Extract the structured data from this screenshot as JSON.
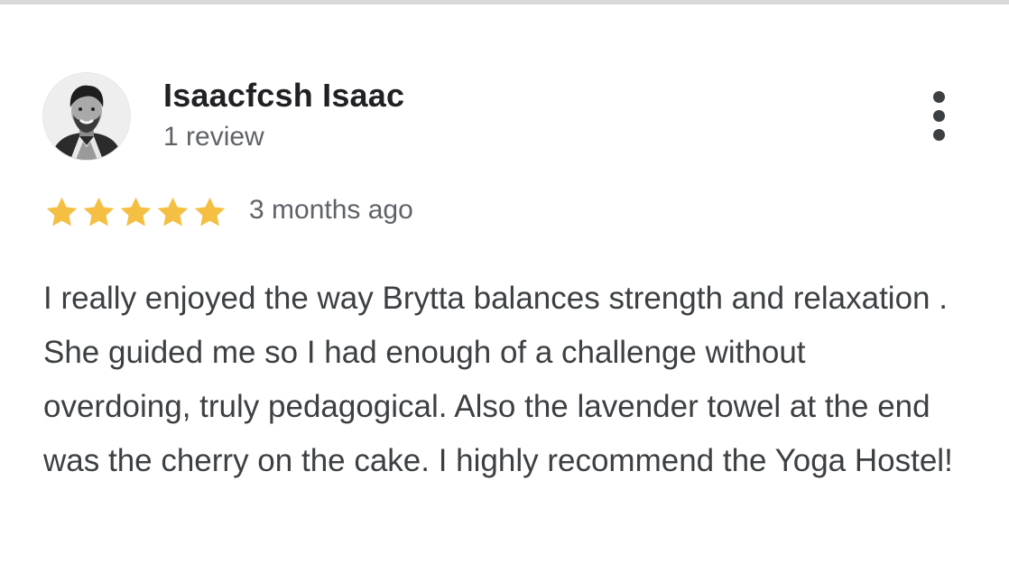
{
  "review": {
    "author_name": "Isaacfcsh Isaac",
    "review_count": "1 review",
    "rating": 5,
    "rating_max": 5,
    "star_color": "#f4bf42",
    "date": "3 months ago",
    "text": "I really enjoyed the way Brytta balances strength and relaxation . She guided me so I had enough of a challenge without overdoing, truly pedagogical. Also the lavender towel at the end was the cherry on the cake. I highly recommend the Yoga Hostel!"
  },
  "icons": {
    "more": "more-vert-icon",
    "star": "star-icon",
    "avatar": "avatar"
  }
}
